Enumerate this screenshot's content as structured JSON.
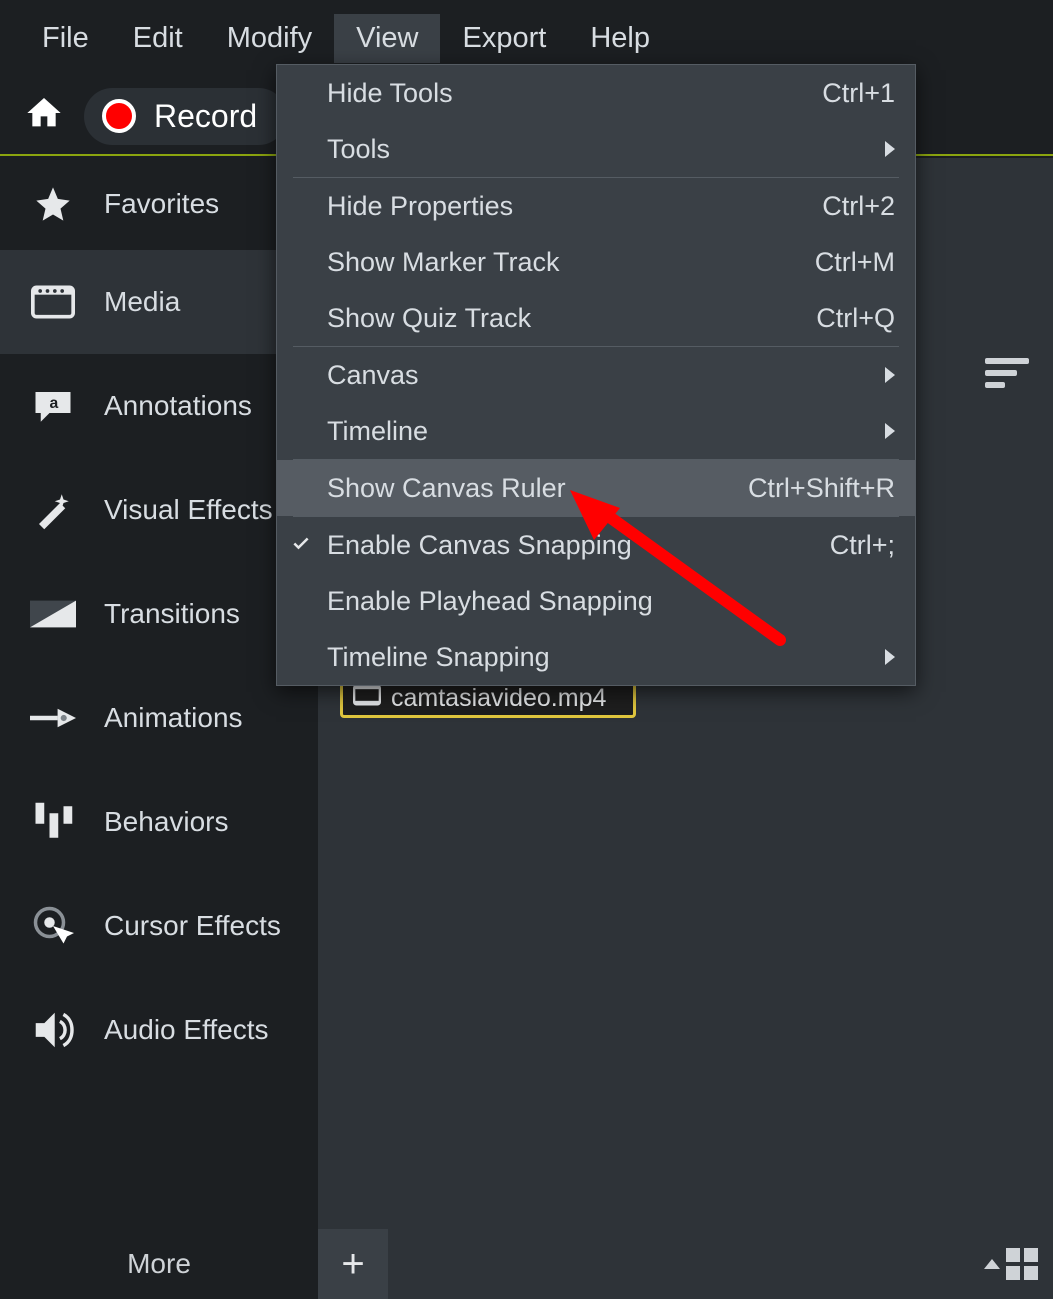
{
  "menubar": {
    "items": [
      {
        "label": "File"
      },
      {
        "label": "Edit"
      },
      {
        "label": "Modify"
      },
      {
        "label": "View",
        "selected": true
      },
      {
        "label": "Export"
      },
      {
        "label": "Help"
      }
    ]
  },
  "toolbar": {
    "record_label": "Record"
  },
  "sidebar": {
    "items": [
      {
        "label": "Favorites",
        "icon": "star-icon"
      },
      {
        "label": "Media",
        "icon": "media-icon",
        "active": true
      },
      {
        "label": "Annotations",
        "icon": "annotations-icon"
      },
      {
        "label": "Visual Effects",
        "icon": "wand-icon"
      },
      {
        "label": "Transitions",
        "icon": "transitions-icon"
      },
      {
        "label": "Animations",
        "icon": "animations-icon"
      },
      {
        "label": "Behaviors",
        "icon": "behaviors-icon"
      },
      {
        "label": "Cursor Effects",
        "icon": "cursor-effects-icon"
      },
      {
        "label": "Audio Effects",
        "icon": "audio-icon"
      }
    ],
    "more_label": "More"
  },
  "media": {
    "file_name": "camtasiavideo.mp4"
  },
  "view_menu": {
    "items": [
      {
        "label": "Hide Tools",
        "shortcut": "Ctrl+1"
      },
      {
        "label": "Tools",
        "submenu": true,
        "sep_after": true
      },
      {
        "label": "Hide Properties",
        "shortcut": "Ctrl+2"
      },
      {
        "label": "Show Marker Track",
        "shortcut": "Ctrl+M"
      },
      {
        "label": "Show Quiz Track",
        "shortcut": "Ctrl+Q",
        "sep_after": true
      },
      {
        "label": "Canvas",
        "submenu": true
      },
      {
        "label": "Timeline",
        "submenu": true,
        "sep_after": true
      },
      {
        "label": "Show Canvas Ruler",
        "shortcut": "Ctrl+Shift+R",
        "highlight": true,
        "sep_after": true
      },
      {
        "label": "Enable Canvas Snapping",
        "shortcut": "Ctrl+;",
        "checked": true
      },
      {
        "label": "Enable Playhead Snapping"
      },
      {
        "label": "Timeline Snapping",
        "submenu": true
      }
    ]
  },
  "bottom": {
    "plus_label": "+"
  }
}
